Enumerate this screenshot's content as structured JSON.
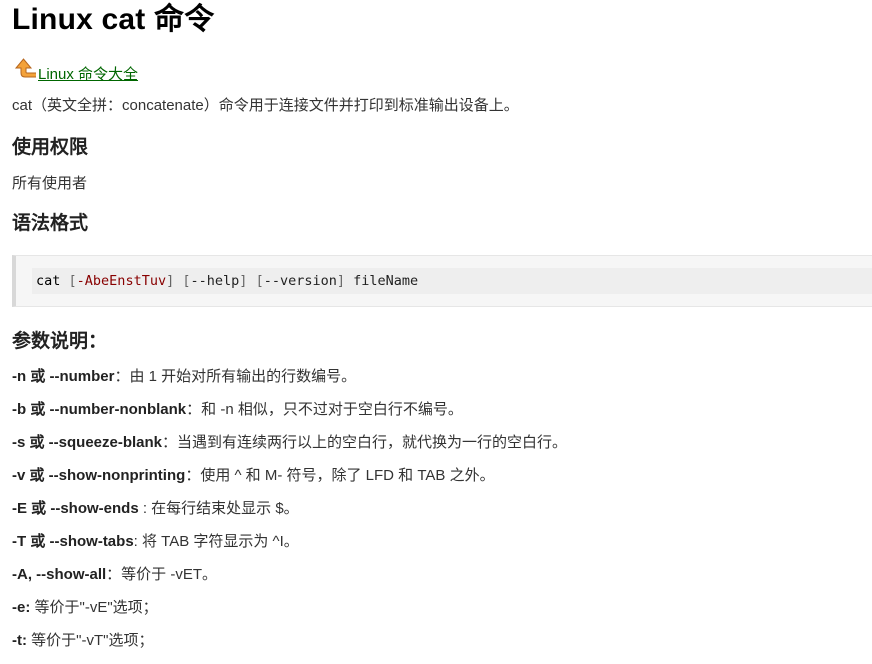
{
  "page_title": "Linux cat 命令",
  "nav_link": {
    "label": " Linux 命令大全",
    "icon": "up-arrow-icon"
  },
  "intro": "cat（英文全拼：concatenate）命令用于连接文件并打印到标准输出设备上。",
  "sections": {
    "permission": {
      "title": "使用权限",
      "text": "所有使用者"
    },
    "syntax": {
      "title": "语法格式",
      "code": {
        "cmd": "cat",
        "bracket_open": "[",
        "bracket_close": "]",
        "opt1": "-AbeEnstTuv",
        "opt2": "--help",
        "opt3": "--version",
        "arg": "fileName"
      }
    },
    "params": {
      "title": "参数说明：",
      "items": [
        {
          "name": "-n 或 --number",
          "desc": "：由 1 开始对所有输出的行数编号。"
        },
        {
          "name": "-b 或 --number-nonblank",
          "desc": "：和 -n 相似，只不过对于空白行不编号。"
        },
        {
          "name": "-s 或 --squeeze-blank",
          "desc": "：当遇到有连续两行以上的空白行，就代换为一行的空白行。"
        },
        {
          "name": "-v 或 --show-nonprinting",
          "desc": "：使用 ^ 和 M- 符号，除了 LFD 和 TAB 之外。"
        },
        {
          "name": "-E 或 --show-ends",
          "desc": " : 在每行结束处显示 $。"
        },
        {
          "name": "-T 或 --show-tabs",
          "desc": ": 将 TAB 字符显示为 ^I。"
        },
        {
          "name": "-A, --show-all",
          "desc": "：等价于 -vET。"
        },
        {
          "name": "-e:",
          "desc": " 等价于\"-vE\"选项；"
        },
        {
          "name": "-t:",
          "desc": " 等价于\"-vT\"选项；"
        }
      ]
    }
  }
}
